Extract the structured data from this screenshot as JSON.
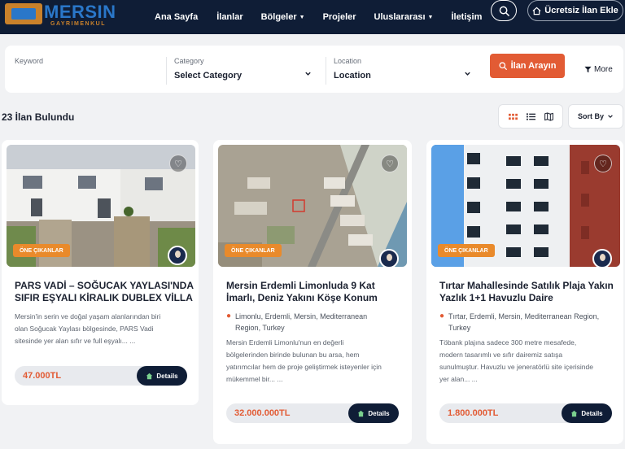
{
  "header": {
    "logo_text": "MERSIN",
    "logo_sub": "GAYRIMENKUL",
    "nav": [
      {
        "label": "Ana Sayfa",
        "dropdown": false
      },
      {
        "label": "İlanlar",
        "dropdown": false
      },
      {
        "label": "Bölgeler",
        "dropdown": true
      },
      {
        "label": "Projeler",
        "dropdown": false
      },
      {
        "label": "Uluslararası",
        "dropdown": true
      },
      {
        "label": "İletişim",
        "dropdown": false
      }
    ],
    "cta_label": "Ücretsiz İlan Ekle"
  },
  "filter": {
    "keyword_label": "Keyword",
    "category_label": "Category",
    "category_value": "Select Category",
    "location_label": "Location",
    "location_value": "Location",
    "search_label": "İlan Arayın",
    "more_label": "More"
  },
  "results": {
    "count_text": "23 İlan Bulundu",
    "sort_label": "Sort By"
  },
  "cards": [
    {
      "badge": "ÖNE ÇIKANLAR",
      "title": [
        "PARS VADİ – SOĞUCAK YAYLASI'NDA",
        "SIFIR EŞYALI KİRALIK DUBLEX VİLLA"
      ],
      "location": [],
      "description": [
        "Mersin'in serin ve doğal yaşam alanlarından biri",
        "olan Soğucak Yaylası bölgesinde, PARS Vadi",
        "sitesinde yer alan sıfır ve full eşyalı... ..."
      ],
      "price": "47.000TL",
      "details_label": "Details"
    },
    {
      "badge": "ÖNE ÇIKANLAR",
      "title": [
        "Mersin Erdemli Limonluda 9 Kat",
        "İmarlı, Deniz Yakını Köşe Konum"
      ],
      "location": [
        "Limonlu, Erdemli, Mersin, Mediterranean",
        "Region, Turkey"
      ],
      "description": [
        "Mersin Erdemli Limonlu'nun en değerli",
        "bölgelerinden birinde bulunan bu arsa, hem",
        "yatırımcılar hem de proje geliştirmek isteyenler için",
        "mükemmel bir... ..."
      ],
      "price": "32.000.000TL",
      "details_label": "Details"
    },
    {
      "badge": "ÖNE ÇIKANLAR",
      "title": [
        "Tırtar Mahallesinde Satılık Plaja Yakın",
        "Yazlık 1+1 Havuzlu Daire"
      ],
      "location": [
        "Tırtar, Erdemli, Mersin, Mediterranean Region,",
        "Turkey"
      ],
      "description": [
        "Töbank plajına sadece 300 metre mesafede,",
        "modern tasarımlı ve sıfır dairemiz satışa",
        "sunulmuştur. Havuzlu ve jeneratörlü site içerisinde",
        "yer alan... ..."
      ],
      "price": "1.800.000TL",
      "details_label": "Details"
    }
  ]
}
